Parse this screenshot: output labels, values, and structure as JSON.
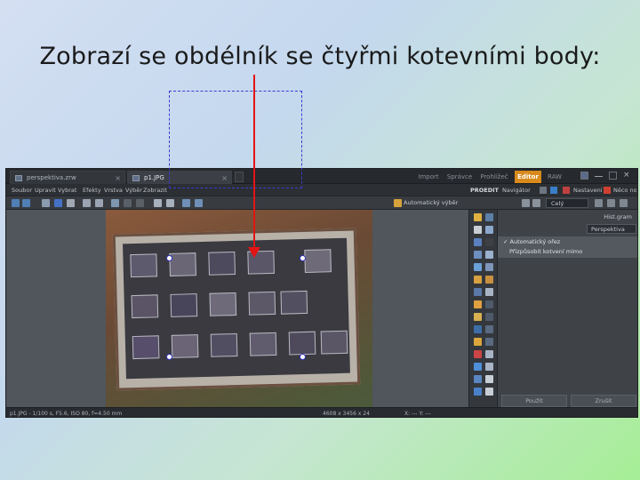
{
  "slide": {
    "title": "Zobrazí se obdélník se čtyřmi kotevními body:"
  },
  "app": {
    "tabs": [
      {
        "label": "perspektiva.zrw",
        "active": false
      },
      {
        "label": "p1.JPG",
        "active": true
      }
    ],
    "modes": [
      "Import",
      "Správce",
      "Prohlížeč",
      "Editor",
      "RAW"
    ],
    "active_mode": "Editor",
    "menu": [
      "Soubor",
      "Upravit",
      "Vybrat",
      "Efekty",
      "Vrstva",
      "Výběr",
      "Zobrazit"
    ],
    "menu_right": {
      "product": "PROEDIT",
      "navigator": "Navigátor",
      "settings": "Nastavení",
      "done": "Něco nové"
    },
    "toolbar": {
      "auto_select_label": "Automatický výběr",
      "zoom_combo": "Celý"
    },
    "panel": {
      "header": "Hist.gram",
      "dropdown": "Perspektiva",
      "items": [
        {
          "label": "Automatický ořez",
          "checked": true
        },
        {
          "label": "Přizpůsobit kotvení mimo",
          "checked": false
        }
      ],
      "buttons": [
        "Použít",
        "Zrušit"
      ]
    },
    "status": {
      "left": "p1.JPG - 1/100 s, F5.6, ISO 80, f=4.50 mm",
      "middle": "4608 x 3456 x 24",
      "right": "X: --- Y: ---"
    },
    "colors": {
      "accent": "#d88a1c",
      "selection": "#3b3bd0",
      "arrow": "#e21414"
    }
  }
}
